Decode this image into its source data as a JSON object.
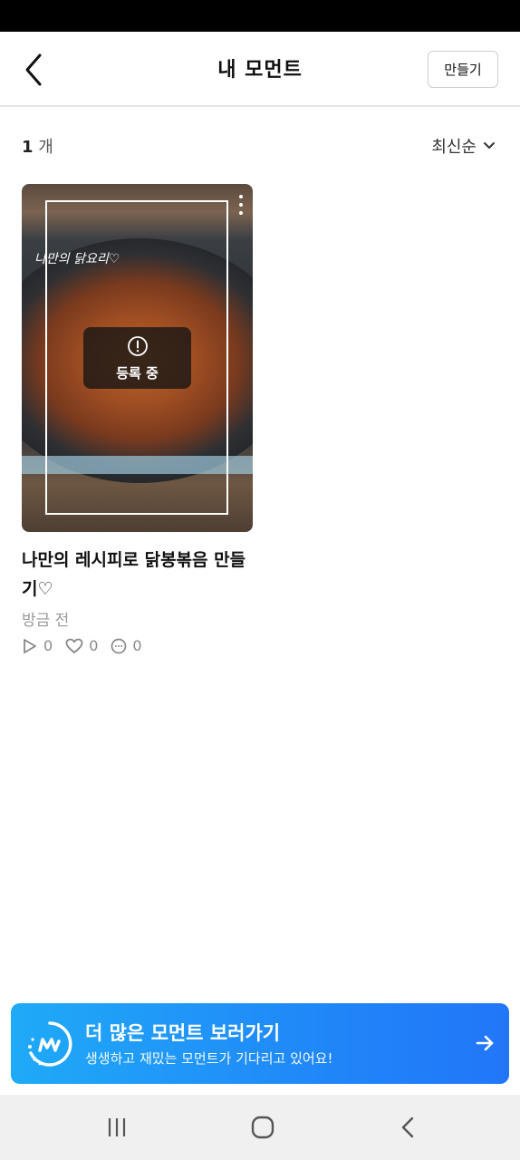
{
  "header": {
    "title": "내 모먼트",
    "create_label": "만들기",
    "back_icon": "chevron-left-icon"
  },
  "list": {
    "count_number": "1",
    "count_unit": "개",
    "sort_label": "최신순"
  },
  "moment": {
    "image_caption": "나만의 닭요리♡",
    "status_label": "등록 중",
    "title": "나만의 레시피로 닭봉볶음 만들기♡",
    "time": "방금 전",
    "plays": "0",
    "likes": "0",
    "comments": "0"
  },
  "banner": {
    "title": "더 많은 모먼트 보러가기",
    "subtitle": "생생하고 재밌는 모먼트가 기다리고 있어요!",
    "color_start": "#1faaf7",
    "color_end": "#2176f8"
  },
  "colors": {
    "status_bar": "#000000",
    "nav_bar": "#f0f0f0"
  }
}
